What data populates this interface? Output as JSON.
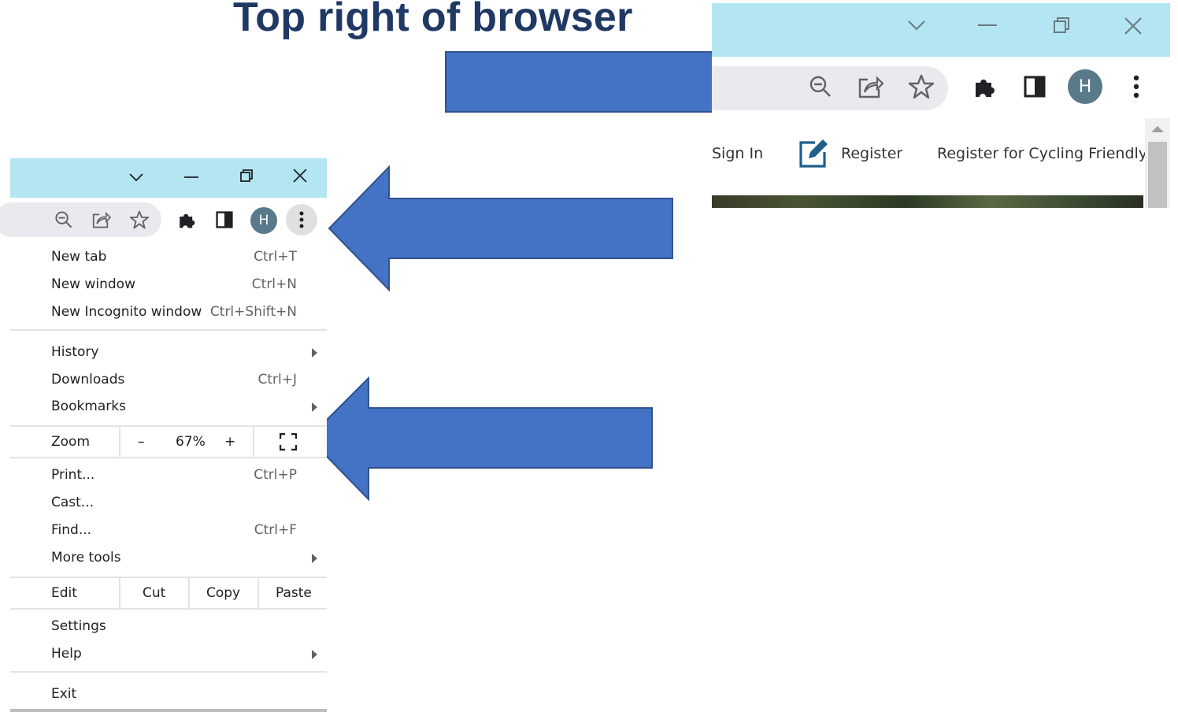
{
  "heading": "Top right of browser",
  "colors": {
    "title": "#1f3864",
    "arrow_fill": "#4472c4",
    "arrow_stroke": "#2f528f",
    "titlebar": "#b3e5f2",
    "avatar": "#587a8a"
  },
  "top_right": {
    "window_controls": [
      "chevron-down-icon",
      "minimize-icon",
      "restore-icon",
      "close-icon"
    ],
    "toolbar_icons": [
      "zoom-out-icon",
      "share-icon",
      "bookmark-star-icon",
      "extensions-icon",
      "side-panel-icon",
      "profile-avatar",
      "menu-kebab-icon"
    ],
    "avatar_letter": "H",
    "links": {
      "sign_in": "Sign In",
      "register": "Register",
      "register_cycling": "Register for Cycling Friendly"
    }
  },
  "menu": {
    "avatar_letter": "H",
    "items_group1": [
      {
        "label": "New tab",
        "shortcut": "Ctrl+T"
      },
      {
        "label": "New window",
        "shortcut": "Ctrl+N"
      },
      {
        "label": "New Incognito window",
        "shortcut": "Ctrl+Shift+N"
      }
    ],
    "items_group2": [
      {
        "label": "History",
        "shortcut": "",
        "submenu": true
      },
      {
        "label": "Downloads",
        "shortcut": "Ctrl+J"
      },
      {
        "label": "Bookmarks",
        "shortcut": "",
        "submenu": true
      }
    ],
    "zoom": {
      "label": "Zoom",
      "minus": "–",
      "value": "67%",
      "plus": "+",
      "fullscreen_icon": "fullscreen-icon"
    },
    "items_group3": [
      {
        "label": "Print...",
        "shortcut": "Ctrl+P"
      },
      {
        "label": "Cast...",
        "shortcut": ""
      },
      {
        "label": "Find...",
        "shortcut": "Ctrl+F"
      },
      {
        "label": "More tools",
        "shortcut": "",
        "submenu": true
      }
    ],
    "edit": {
      "label": "Edit",
      "cut": "Cut",
      "copy": "Copy",
      "paste": "Paste"
    },
    "items_group4": [
      {
        "label": "Settings",
        "shortcut": ""
      },
      {
        "label": "Help",
        "shortcut": "",
        "submenu": true
      }
    ],
    "exit": "Exit"
  }
}
